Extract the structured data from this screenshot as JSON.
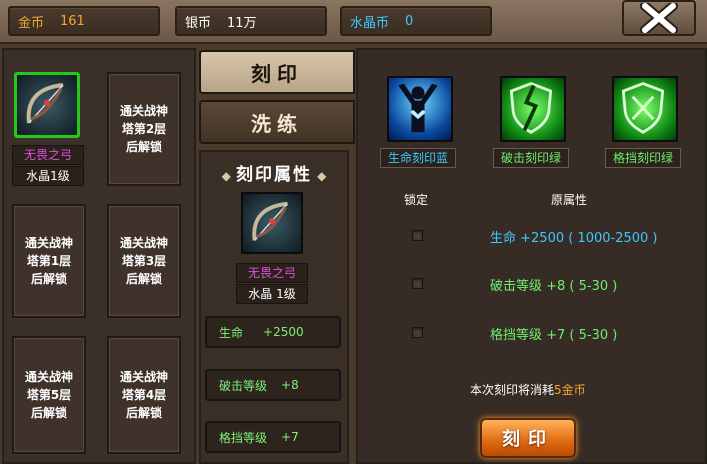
{
  "currency": {
    "gold": {
      "label": "金币",
      "value": "161"
    },
    "silver": {
      "label": "银币",
      "value": "11万"
    },
    "crystal": {
      "label": "水晶币",
      "value": "0"
    }
  },
  "tabs": {
    "engrave": "刻印",
    "refine": "洗练"
  },
  "slots": {
    "equipped": {
      "name": "无畏之弓",
      "level": "水晶1级"
    },
    "locked": [
      {
        "line1": "通关战神",
        "line2": "塔第2层",
        "line3": "后解锁"
      },
      {
        "line1": "通关战神",
        "line2": "塔第1层",
        "line3": "后解锁"
      },
      {
        "line1": "通关战神",
        "line2": "塔第3层",
        "line3": "后解锁"
      },
      {
        "line1": "通关战神",
        "line2": "塔第5层",
        "line3": "后解锁"
      },
      {
        "line1": "通关战神",
        "line2": "塔第4层",
        "line3": "后解锁"
      }
    ]
  },
  "engrave_attr": {
    "title": "刻印属性",
    "item_name": "无畏之弓",
    "item_level": "水晶 1级",
    "attrs": [
      {
        "name": "生命",
        "value": "+2500"
      },
      {
        "name": "破击等级",
        "value": "+8"
      },
      {
        "name": "格挡等级",
        "value": "+7"
      }
    ]
  },
  "runes": [
    {
      "label": "生命刻印蓝",
      "color": "#3ec8ff"
    },
    {
      "label": "破击刻印绿",
      "color": "#6cf06a"
    },
    {
      "label": "格挡刻印绿",
      "color": "#6cf06a"
    }
  ],
  "table": {
    "lock_header": "锁定",
    "attr_header": "原属性",
    "rows": [
      {
        "text": "生命 +2500 ( 1000-2500 )",
        "color": "#3ec8ff"
      },
      {
        "text": "破击等级 +8 ( 5-30 )",
        "color": "#6cf06a"
      },
      {
        "text": "格挡等级 +7 ( 5-30 )",
        "color": "#6cf06a"
      }
    ]
  },
  "cost": {
    "prefix": "本次刻印将消耗",
    "amount": "5金币"
  },
  "button": {
    "label": "刻印"
  },
  "colors": {
    "gold": "#f0a830",
    "silver": "#ffffff",
    "crystal": "#3ec8ff"
  }
}
